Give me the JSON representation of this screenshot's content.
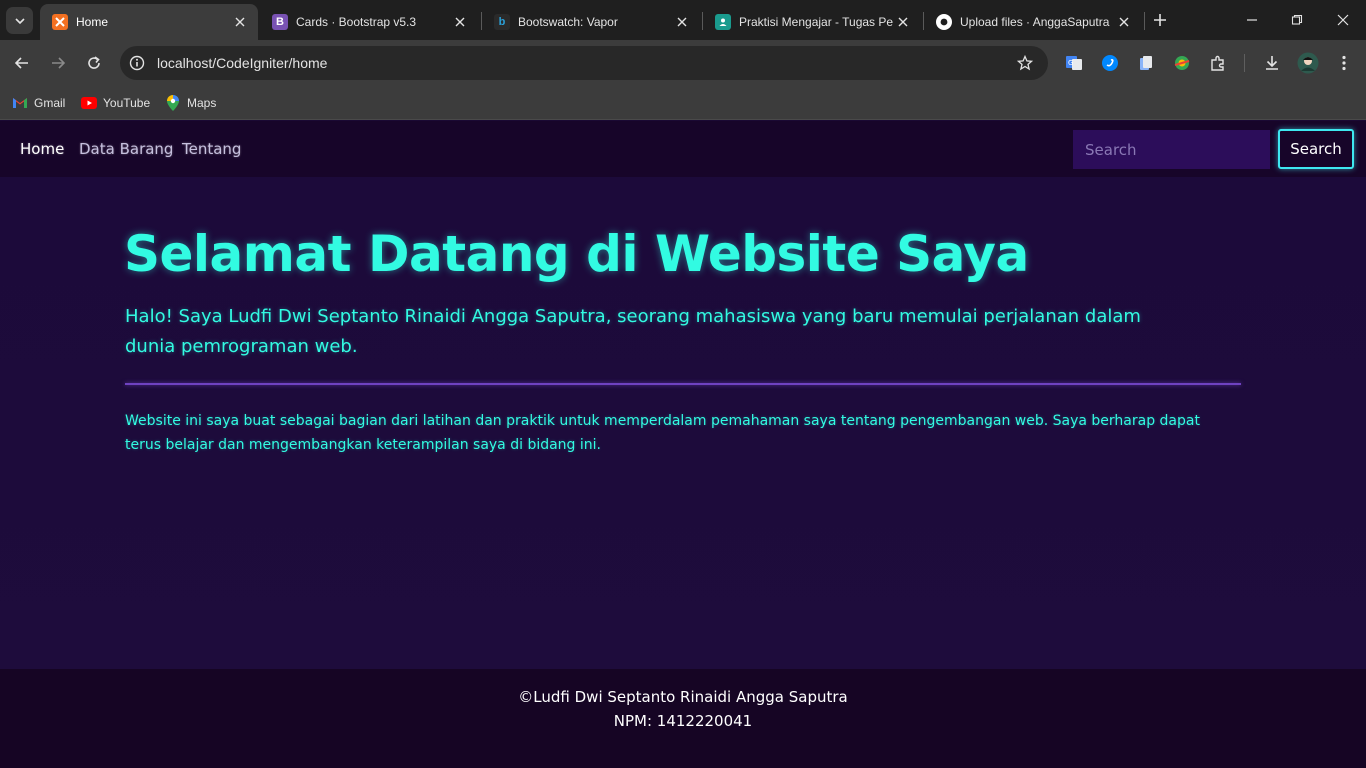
{
  "browser": {
    "tabs": [
      {
        "title": "Home",
        "active": true,
        "favicon": "xampp-icon",
        "favicon_color": "#f37021"
      },
      {
        "title": "Cards · Bootstrap v5.3",
        "active": false,
        "favicon": "bootstrap-icon",
        "favicon_color": "#7952b3"
      },
      {
        "title": "Bootswatch: Vapor",
        "active": false,
        "favicon": "bootswatch-icon",
        "favicon_color": "#2a9fd6"
      },
      {
        "title": "Praktisi Mengajar - Tugas Pe",
        "active": false,
        "favicon": "classroom-icon",
        "favicon_color": "#1a9b8e"
      },
      {
        "title": "Upload files · AnggaSaputra",
        "active": false,
        "favicon": "github-icon",
        "favicon_color": "#ffffff"
      }
    ],
    "address": "localhost/CodeIgniter/home",
    "bookmarks": [
      {
        "label": "Gmail",
        "icon": "gmail-icon"
      },
      {
        "label": "YouTube",
        "icon": "youtube-icon"
      },
      {
        "label": "Maps",
        "icon": "maps-icon"
      }
    ]
  },
  "site": {
    "nav": {
      "links": [
        "Home",
        "Data Barang",
        "Tentang"
      ],
      "search_placeholder": "Search",
      "search_button": "Search"
    },
    "hero": {
      "title": "Selamat Datang di Website Saya",
      "lead": "Halo! Saya Ludfi Dwi Septanto Rinaidi Angga Saputra, seorang mahasiswa yang baru memulai perjalanan dalam dunia pemrograman web.",
      "text": "Website ini saya buat sebagai bagian dari latihan dan praktik untuk memperdalam pemahaman saya tentang pengembangan web. Saya berharap dapat terus belajar dan mengembangkan keterampilan saya di bidang ini."
    },
    "footer": {
      "copyright": "©Ludfi Dwi Septanto Rinaidi Angga Saputra",
      "npm": "NPM: 1412220041"
    }
  },
  "colors": {
    "accent": "#32fbe2",
    "navbar_bg": "#170529",
    "page_bg": "#1c0a3a",
    "divider": "#6f42c1"
  }
}
